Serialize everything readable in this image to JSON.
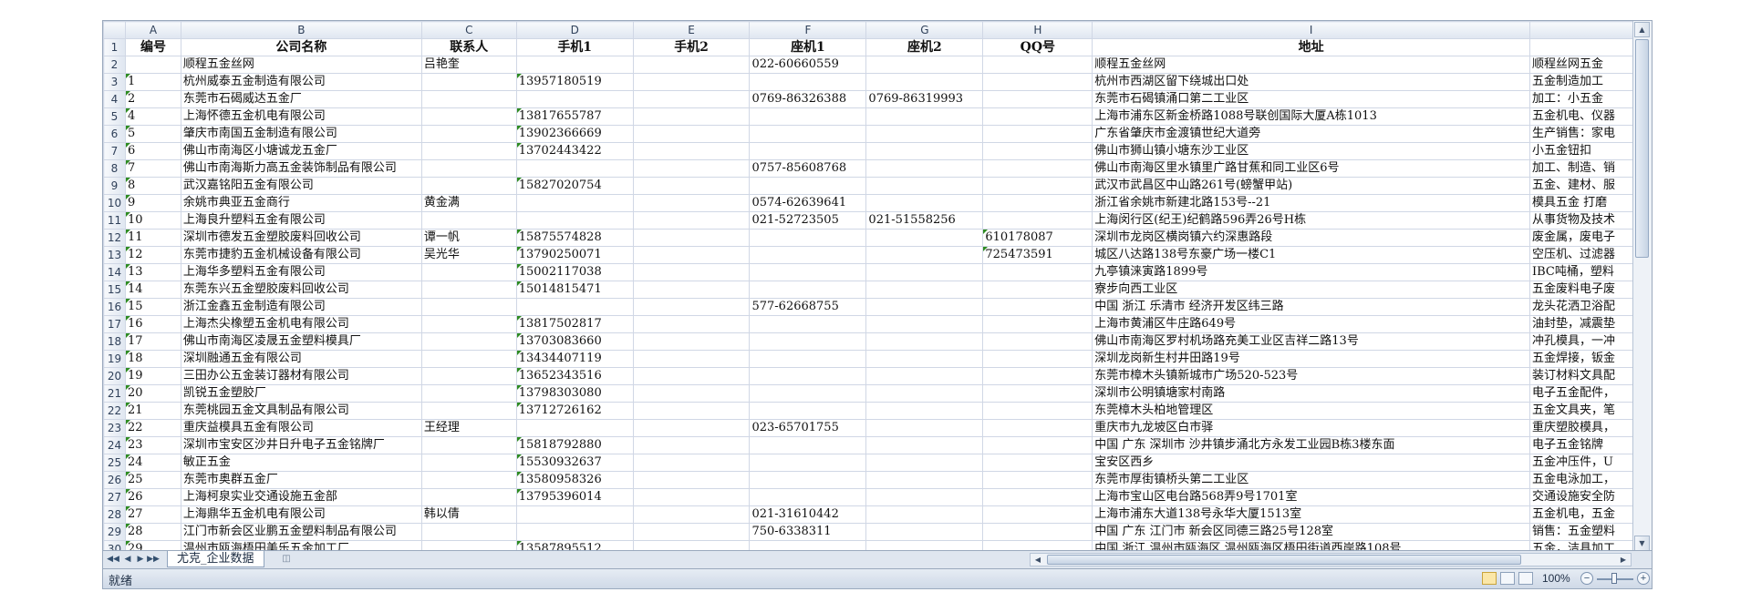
{
  "columns": [
    "A",
    "B",
    "C",
    "D",
    "E",
    "F",
    "G",
    "H",
    "I",
    ""
  ],
  "header_row": [
    "编号",
    "公司名称",
    "联系人",
    "手机1",
    "手机2",
    "座机1",
    "座机2",
    "QQ号",
    "地址",
    ""
  ],
  "rows": [
    {
      "n": "2",
      "c": [
        "",
        "顺程五金丝网",
        "吕艳奎",
        "",
        "",
        "022-60660559",
        "",
        "",
        "顺程五金丝网",
        "顺程丝网五金"
      ]
    },
    {
      "n": "3",
      "c": [
        "1",
        "杭州威泰五金制造有限公司",
        "",
        "13957180519",
        "",
        "",
        "",
        "",
        "杭州市西湖区留下绕城出口处",
        "五金制造加工"
      ]
    },
    {
      "n": "4",
      "c": [
        "2",
        "东莞市石碣威达五金厂",
        "",
        "",
        "",
        "0769-86326388",
        "0769-86319993",
        "",
        "东莞市石碣镇涌口第二工业区",
        "加工：小五金"
      ]
    },
    {
      "n": "5",
      "c": [
        "4",
        "上海怀德五金机电有限公司",
        "",
        "13817655787",
        "",
        "",
        "",
        "",
        "上海市浦东区新金桥路1088号联创国际大厦A栋1013",
        "五金机电、仪器"
      ]
    },
    {
      "n": "6",
      "c": [
        "5",
        "肇庆市南国五金制造有限公司",
        "",
        "13902366669",
        "",
        "",
        "",
        "",
        "广东省肇庆市金渡镇世纪大道旁",
        "生产销售：家电"
      ]
    },
    {
      "n": "7",
      "c": [
        "6",
        "佛山市南海区小塘诚龙五金厂",
        "",
        "13702443422",
        "",
        "",
        "",
        "",
        "佛山市狮山镇小塘东沙工业区",
        "小五金钮扣"
      ]
    },
    {
      "n": "8",
      "c": [
        "7",
        "佛山市南海斯力高五金装饰制品有限公司",
        "",
        "",
        "",
        "0757-85608768",
        "",
        "",
        "佛山市南海区里水镇里广路甘蕉和同工业区6号",
        "加工、制造、销"
      ]
    },
    {
      "n": "9",
      "c": [
        "8",
        "武汉嘉铭阳五金有限公司",
        "",
        "15827020754",
        "",
        "",
        "",
        "",
        "武汉市武昌区中山路261号(螃蟹甲站)",
        "五金、建材、服"
      ]
    },
    {
      "n": "10",
      "c": [
        "9",
        "余姚市典亚五金商行",
        "黄金满",
        "",
        "",
        "0574-62639641",
        "",
        "",
        "浙江省余姚市新建北路153号--21",
        "模具五金 打磨"
      ]
    },
    {
      "n": "11",
      "c": [
        "10",
        "上海良升塑料五金有限公司",
        "",
        "",
        "",
        "021-52723505",
        "021-51558256",
        "",
        "上海闵行区(纪王)纪鹤路596弄26号H栋",
        "从事货物及技术"
      ]
    },
    {
      "n": "12",
      "c": [
        "11",
        "深圳市德发五金塑胶废料回收公司",
        "谭一帆",
        "15875574828",
        "",
        "",
        "",
        "610178087",
        "深圳市龙岗区横岗镇六约深惠路段",
        "废金属，废电子"
      ]
    },
    {
      "n": "13",
      "c": [
        "12",
        "东莞市捷豹五金机械设备有限公司",
        "吴光华",
        "13790250071",
        "",
        "",
        "",
        "725473591",
        "城区八达路138号东豪广场一楼C1",
        "空压机、过滤器"
      ]
    },
    {
      "n": "14",
      "c": [
        "13",
        "上海华多塑料五金有限公司",
        "",
        "15002117038",
        "",
        "",
        "",
        "",
        "九亭镇涞寅路1899号",
        "IBC吨桶，塑料"
      ]
    },
    {
      "n": "15",
      "c": [
        "14",
        "东莞东兴五金塑胶废料回收公司",
        "",
        "15014815471",
        "",
        "",
        "",
        "",
        "寮步向西工业区",
        "五金废料电子废"
      ]
    },
    {
      "n": "16",
      "c": [
        "15",
        "浙江金鑫五金制造有限公司",
        "",
        "",
        "",
        "577-62668755",
        "",
        "",
        "中国  浙江  乐清市  经济开发区纬三路",
        "龙头花洒卫浴配"
      ]
    },
    {
      "n": "17",
      "c": [
        "16",
        "上海杰尖橡塑五金机电有限公司",
        "",
        "13817502817",
        "",
        "",
        "",
        "",
        "上海市黄浦区牛庄路649号",
        "油封垫，减震垫"
      ]
    },
    {
      "n": "18",
      "c": [
        "17",
        "佛山市南海区凌晟五金塑料模具厂",
        "",
        "13703083660",
        "",
        "",
        "",
        "",
        "佛山市南海区罗村机场路充美工业区吉祥二路13号",
        "冲孔模具，一冲"
      ]
    },
    {
      "n": "19",
      "c": [
        "18",
        "深圳融通五金有限公司",
        "",
        "13434407119",
        "",
        "",
        "",
        "",
        "深圳龙岗新生村井田路19号",
        "五金焊接，钣金"
      ]
    },
    {
      "n": "20",
      "c": [
        "19",
        "三田办公五金装订器材有限公司",
        "",
        "13652343516",
        "",
        "",
        "",
        "",
        "东莞市樟木头镇新城市广场520-523号",
        "装订材料文具配"
      ]
    },
    {
      "n": "21",
      "c": [
        "20",
        "凯锐五金塑胶厂",
        "",
        "13798303080",
        "",
        "",
        "",
        "",
        "深圳市公明镇塘家村南路",
        "电子五金配件，"
      ]
    },
    {
      "n": "22",
      "c": [
        "21",
        "东莞桃园五金文具制品有限公司",
        "",
        "13712726162",
        "",
        "",
        "",
        "",
        "东莞樟木头柏地管理区",
        "五金文具夹，笔"
      ]
    },
    {
      "n": "23",
      "c": [
        "22",
        "重庆益模具五金有限公司",
        "王经理",
        "",
        "",
        "023-65701755",
        "",
        "",
        "重庆市九龙坡区白市驿",
        "重庆塑胶模具，"
      ]
    },
    {
      "n": "24",
      "c": [
        "23",
        "深圳市宝安区沙井日升电子五金铭牌厂",
        "",
        "15818792880",
        "",
        "",
        "",
        "",
        "中国  广东  深圳市  沙井镇步涌北方永发工业园B栋3楼东面",
        "电子五金铭牌"
      ]
    },
    {
      "n": "25",
      "c": [
        "24",
        "敏正五金",
        "",
        "15530932637",
        "",
        "",
        "",
        "",
        "宝安区西乡",
        "五金冲压件，U"
      ]
    },
    {
      "n": "26",
      "c": [
        "25",
        "东莞市奥群五金厂",
        "",
        "13580958326",
        "",
        "",
        "",
        "",
        "东莞市厚街镇桥头第二工业区",
        "五金电泳加工，"
      ]
    },
    {
      "n": "27",
      "c": [
        "26",
        "上海柯泉实业交通设施五金部",
        "",
        "13795396014",
        "",
        "",
        "",
        "",
        "上海市宝山区电台路568弄9号1701室",
        "交通设施安全防"
      ]
    },
    {
      "n": "28",
      "c": [
        "27",
        "上海鼎华五金机电有限公司",
        "韩以倩",
        "",
        "",
        "021-31610442",
        "",
        "",
        "上海市浦东大道138号永华大厦1513室",
        "五金机电，五金"
      ]
    },
    {
      "n": "29",
      "c": [
        "28",
        "江门市新会区业鹏五金塑料制品有限公司",
        "",
        "",
        "",
        "750-6338311",
        "",
        "",
        "中国  广东  江门市  新会区同德三路25号128室",
        "销售：五金塑料"
      ]
    },
    {
      "n": "30",
      "c": [
        "29",
        "温州市瓯海梧田美乐五金加工厂",
        "",
        "13587895512",
        "",
        "",
        "",
        "",
        "中国  浙江  温州市瓯海区  温州瓯海区梧田街道西岸路108号",
        "五金，洁具加工"
      ]
    }
  ],
  "sheet_tab": "尤克_企业数据",
  "status_text": "就绪",
  "zoom": "100%",
  "icons": {
    "tab_first": "◀◀",
    "tab_prev": "◀",
    "tab_next": "▶",
    "tab_last": "▶▶",
    "scroll_up": "▲",
    "scroll_down": "▼",
    "scroll_left": "◀",
    "scroll_right": "▶",
    "zoom_minus": "−",
    "zoom_plus": "+"
  }
}
